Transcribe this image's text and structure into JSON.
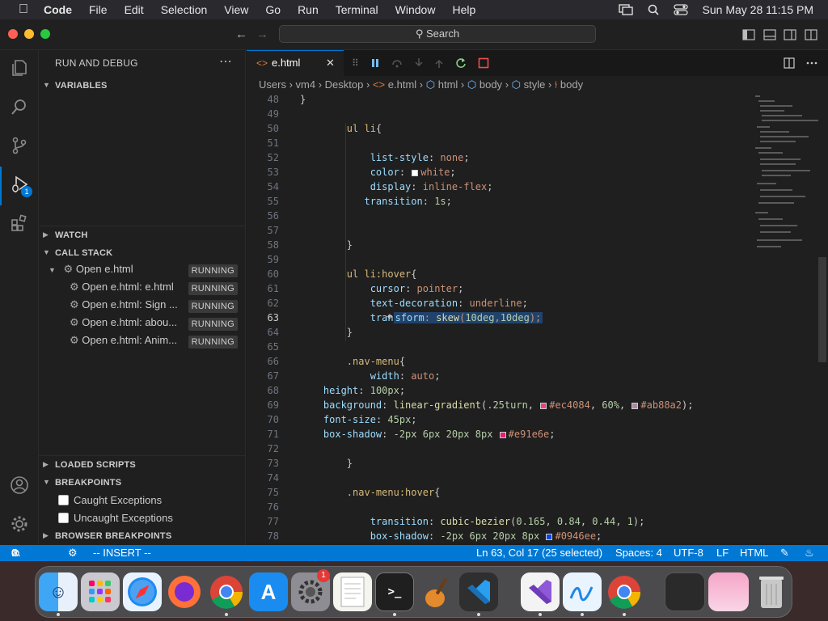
{
  "menubar": {
    "app": "Code",
    "items": [
      "File",
      "Edit",
      "Selection",
      "View",
      "Go",
      "Run",
      "Terminal",
      "Window",
      "Help"
    ],
    "datetime": "Sun May 28  11:15 PM"
  },
  "titlebar": {
    "search": "Search"
  },
  "activity": {
    "debug_badge": "1"
  },
  "sidebar": {
    "title": "RUN AND DEBUG",
    "variables": "VARIABLES",
    "watch": "WATCH",
    "call_stack": "CALL STACK",
    "stack": [
      {
        "label": "Open e.html",
        "status": "RUNNING"
      },
      {
        "label": "Open e.html: e.html",
        "status": "RUNNING"
      },
      {
        "label": "Open e.html: Sign ...",
        "status": "RUNNING"
      },
      {
        "label": "Open e.html: abou...",
        "status": "RUNNING"
      },
      {
        "label": "Open e.html: Anim...",
        "status": "RUNNING"
      }
    ],
    "loaded_scripts": "LOADED SCRIPTS",
    "breakpoints": "BREAKPOINTS",
    "bp_items": [
      "Caught Exceptions",
      "Uncaught Exceptions"
    ],
    "browser_breakpoints": "BROWSER BREAKPOINTS"
  },
  "tab": {
    "name": "e.html"
  },
  "breadcrumb": [
    "Users",
    "vm4",
    "Desktop",
    "e.html",
    "html",
    "body",
    "style",
    "body"
  ],
  "editor": {
    "current_line": 63,
    "lines": [
      48,
      49,
      50,
      51,
      52,
      53,
      54,
      55,
      56,
      57,
      58,
      59,
      60,
      61,
      62,
      63,
      64,
      65,
      66,
      67,
      68,
      69,
      70,
      71,
      72,
      73,
      74,
      75,
      76,
      77,
      78
    ]
  },
  "colors": {
    "ec4084": "#ec4084",
    "ab88a2": "#ab88a2",
    "e91e6e": "#e91e6e",
    "0946ee": "#0946ee",
    "accent": "#0078d4"
  },
  "statusbar": {
    "errors": "0",
    "warnings": "0",
    "mode": "-- INSERT --",
    "position": "Ln 63, Col 17 (25 selected)",
    "spaces": "Spaces: 4",
    "encoding": "UTF-8",
    "eol": "LF",
    "language": "HTML"
  }
}
